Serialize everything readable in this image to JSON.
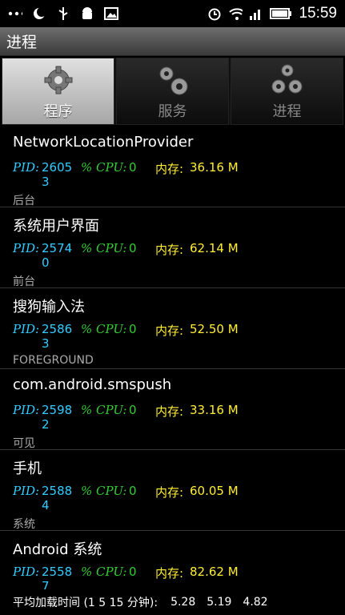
{
  "statusbar": {
    "time": "15:59",
    "icons_left": [
      "more-dots-icon",
      "moon-icon",
      "usb-icon",
      "android-icon",
      "image-icon"
    ],
    "icons_right": [
      "alarm-icon",
      "wifi-icon",
      "signal-icon",
      "battery-icon"
    ]
  },
  "app": {
    "title": "进程"
  },
  "tabs": [
    {
      "label": "程序",
      "icon": "gear-icon",
      "active": true
    },
    {
      "label": "服务",
      "icon": "gears-icon",
      "active": false
    },
    {
      "label": "进程",
      "icon": "gears-icon",
      "active": false
    }
  ],
  "labels": {
    "pid": "PID:",
    "cpu": "% CPU:",
    "mem": "内存:"
  },
  "processes": [
    {
      "name": "NetworkLocationProvider",
      "pid": "26053",
      "cpu": "0",
      "mem": "36.16 M",
      "state": "后台"
    },
    {
      "name": "系统用户界面",
      "pid": "25740",
      "cpu": "0",
      "mem": "62.14 M",
      "state": "前台"
    },
    {
      "name": "搜狗输入法",
      "pid": "25863",
      "cpu": "0",
      "mem": "52.50 M",
      "state": "FOREGROUND"
    },
    {
      "name": "com.android.smspush",
      "pid": "25982",
      "cpu": "0",
      "mem": "33.16 M",
      "state": "可见"
    },
    {
      "name": "手机",
      "pid": "25884",
      "cpu": "0",
      "mem": "60.05 M",
      "state": "系统"
    },
    {
      "name": "Android 系统",
      "pid": "25587",
      "cpu": "0",
      "mem": "82.62 M",
      "state": ""
    }
  ],
  "footer": {
    "label": "平均加载时间 (1 5 15 分钟):",
    "v1": "5.28",
    "v5": "5.19",
    "v15": "4.82"
  }
}
